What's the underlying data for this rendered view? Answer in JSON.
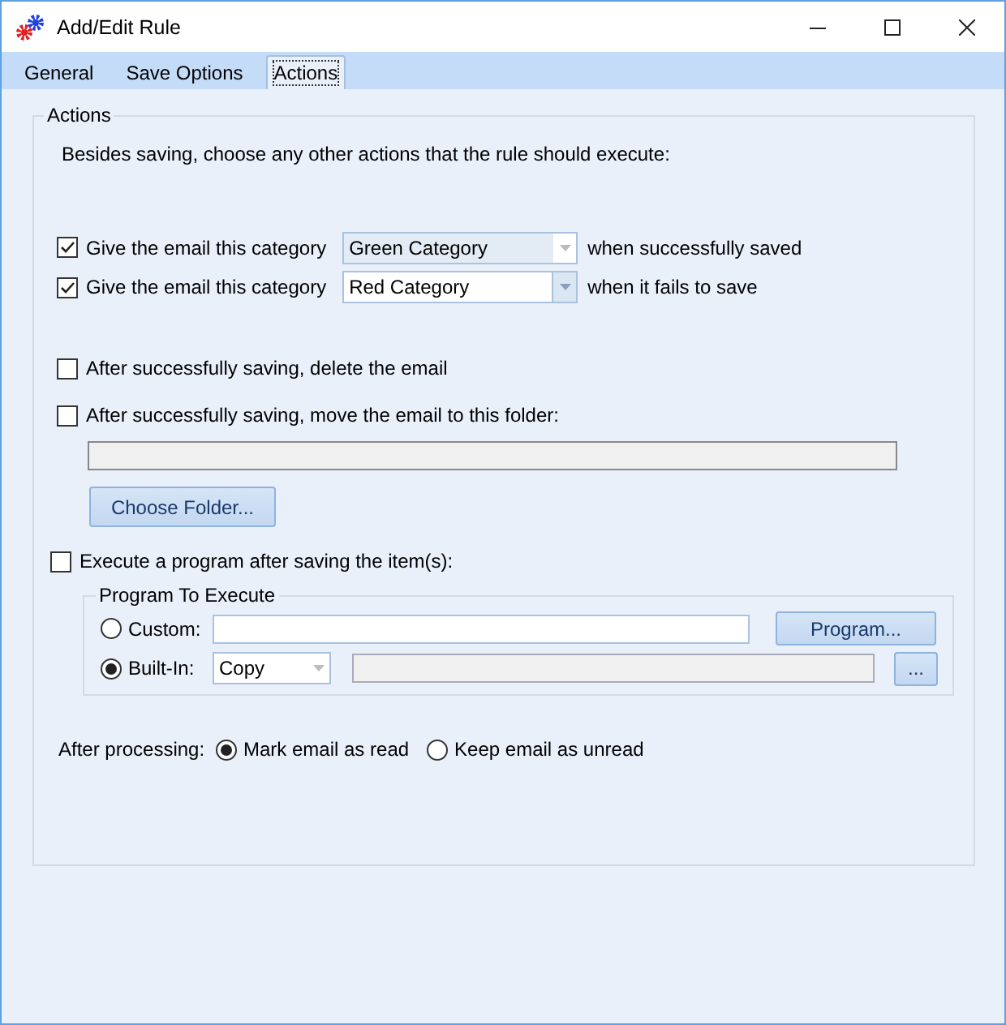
{
  "window": {
    "title": "Add/Edit Rule"
  },
  "tabs": [
    {
      "label": "General",
      "selected": false
    },
    {
      "label": "Save Options",
      "selected": false
    },
    {
      "label": "Actions",
      "selected": true
    }
  ],
  "actions_group": {
    "title": "Actions",
    "intro": "Besides saving, choose any other actions that the rule should execute:",
    "category_rows": [
      {
        "label": "Give the email this category",
        "checked": true,
        "value": "Green Category",
        "focused": false,
        "suffix": "when successfully saved"
      },
      {
        "label": "Give the email this category",
        "checked": true,
        "value": "Red Category",
        "focused": true,
        "suffix": "when it fails to save"
      }
    ],
    "delete_email": {
      "label": "After successfully saving, delete the email",
      "checked": false
    },
    "move_email": {
      "label": "After successfully saving, move the email to this folder:",
      "checked": false,
      "button": "Choose Folder..."
    },
    "execute_program": {
      "label": "Execute a program after saving the item(s):",
      "checked": false,
      "group_title": "Program To Execute",
      "options": [
        {
          "kind": "text",
          "label": "Custom:",
          "selected": false,
          "button": "Program..."
        },
        {
          "kind": "combo",
          "label": "Built-In:",
          "selected": true,
          "value": "Copy",
          "button": "..."
        }
      ]
    },
    "after_processing": {
      "label": "After processing:",
      "options": [
        {
          "label": "Mark email as read",
          "selected": true
        },
        {
          "label": "Keep email as unread",
          "selected": false
        }
      ]
    }
  }
}
